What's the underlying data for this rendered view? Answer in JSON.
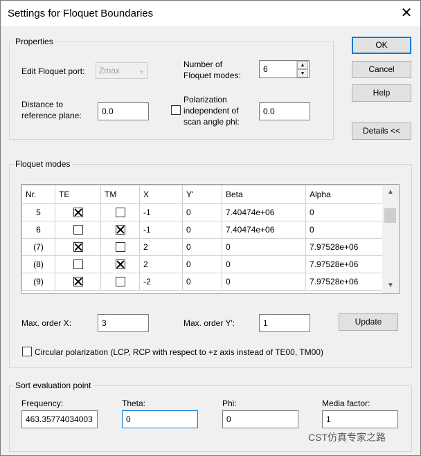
{
  "window": {
    "title": "Settings for Floquet Boundaries",
    "close_glyph": "✕"
  },
  "properties": {
    "group_label": "Properties",
    "edit_port_label": "Edit Floquet port:",
    "edit_port_value": "Zmax",
    "num_modes_label_1": "Number of",
    "num_modes_label_2": "Floquet modes:",
    "num_modes_value": "6",
    "distance_label_1": "Distance to",
    "distance_label_2": "reference plane:",
    "distance_value": "0.0",
    "polarization_label_1": "Polarization",
    "polarization_label_2": "independent of",
    "polarization_label_3": "scan angle phi:",
    "polarization_value": "0.0"
  },
  "buttons": {
    "ok": "OK",
    "cancel": "Cancel",
    "help": "Help",
    "details": "Details <<",
    "update": "Update"
  },
  "floquet": {
    "group_label": "Floquet modes",
    "columns": [
      "Nr.",
      "TE",
      "TM",
      "X",
      "Y'",
      "Beta",
      "Alpha"
    ],
    "rows": [
      {
        "nr": "5",
        "te": true,
        "tm": false,
        "x": "-1",
        "y": "0",
        "beta": "7.40474e+06",
        "alpha": "0"
      },
      {
        "nr": "6",
        "te": false,
        "tm": true,
        "x": "-1",
        "y": "0",
        "beta": "7.40474e+06",
        "alpha": "0"
      },
      {
        "nr": "(7)",
        "te": true,
        "tm": false,
        "x": "2",
        "y": "0",
        "beta": "0",
        "alpha": "7.97528e+06"
      },
      {
        "nr": "(8)",
        "te": false,
        "tm": true,
        "x": "2",
        "y": "0",
        "beta": "0",
        "alpha": "7.97528e+06"
      },
      {
        "nr": "(9)",
        "te": true,
        "tm": false,
        "x": "-2",
        "y": "0",
        "beta": "0",
        "alpha": "7.97528e+06"
      }
    ],
    "max_x_label": "Max. order X:",
    "max_x_value": "3",
    "max_y_label": "Max. order Y':",
    "max_y_value": "1",
    "circular_label": "Circular polarization (LCP, RCP with respect to +z axis instead of TE00, TM00)"
  },
  "sort": {
    "group_label": "Sort evaluation point",
    "frequency_label": "Frequency:",
    "frequency_value": "463.35774034003",
    "theta_label": "Theta:",
    "theta_value": "0",
    "phi_label": "Phi:",
    "phi_value": "0",
    "media_label": "Media factor:",
    "media_value": "1"
  },
  "watermark": "CST仿真专家之路"
}
